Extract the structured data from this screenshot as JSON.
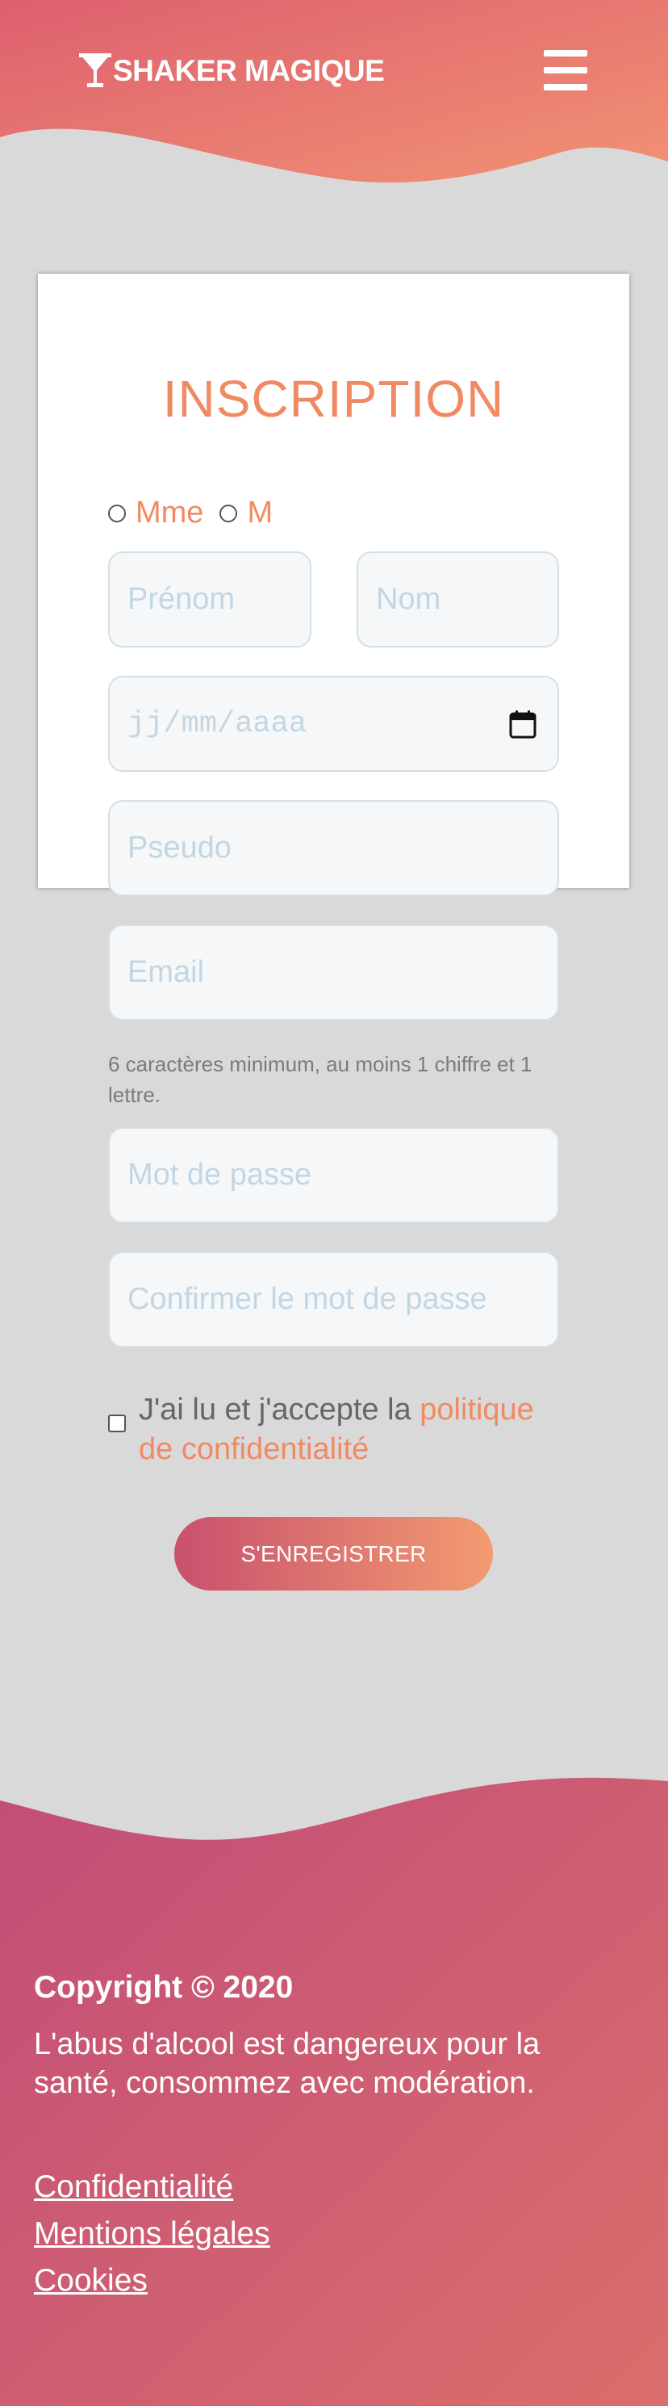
{
  "header": {
    "brand": "SHAKER MAGIQUE",
    "brand_icon": "cocktail-glass-icon",
    "menu_icon": "hamburger-menu-icon",
    "gradient_colors": [
      "#e0606d",
      "#f39274"
    ]
  },
  "form": {
    "title": "INSCRIPTION",
    "civility": {
      "options": [
        "Mme",
        "M"
      ]
    },
    "firstname_placeholder": "Prénom",
    "lastname_placeholder": "Nom",
    "birthdate_placeholder": "jj/mm/aaaa",
    "pseudo_placeholder": "Pseudo",
    "email_placeholder": "Email",
    "password_hint": "6 caractères minimum, au moins 1 chiffre et 1 lettre.",
    "password_placeholder": "Mot de passe",
    "confirm_placeholder": "Confirmer le mot de passe",
    "terms_text": "J'ai lu et j'accepte la ",
    "terms_link": "politique de confidentialité",
    "submit_label": "S'ENREGISTRER",
    "accent_color": "#f08a63"
  },
  "footer": {
    "copyright": "Copyright © 2020",
    "warning": "L'abus d'alcool est dangereux pour la santé, consommez avec modération.",
    "links": [
      "Confidentialité",
      "Mentions légales",
      "Cookies"
    ],
    "gradient_colors": [
      "#c3507a",
      "#d86c6e"
    ]
  }
}
